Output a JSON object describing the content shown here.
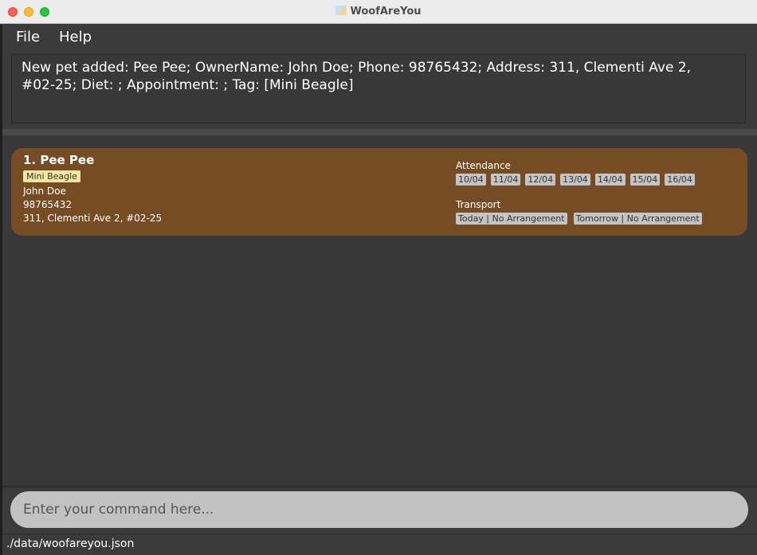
{
  "window": {
    "title": "WoofAreYou"
  },
  "menu": {
    "file": "File",
    "help": "Help"
  },
  "result": {
    "line1": "New pet added: Pee Pee; OwnerName: John Doe; Phone: 98765432; Address: 311, Clementi Ave 2,",
    "line2": "#02-25; Diet: ; Appointment: ; Tag: [Mini Beagle]"
  },
  "pets": [
    {
      "index_name": "1.  Pee Pee",
      "tag": "Mini Beagle",
      "owner": "John Doe",
      "phone": "98765432",
      "address": "311, Clementi Ave 2, #02-25",
      "attendance_label": "Attendance",
      "attendance": [
        "10/04",
        "11/04",
        "12/04",
        "13/04",
        "14/04",
        "15/04",
        "16/04"
      ],
      "transport_label": "Transport",
      "transport": [
        "Today | No Arrangement",
        "Tomorrow | No Arrangement"
      ]
    }
  ],
  "command": {
    "placeholder": "Enter your command here..."
  },
  "status": {
    "path": "./data/woofareyou.json"
  },
  "colors": {
    "card": "#754c24",
    "tag": "#f5e6a1",
    "chip": "#c4c4c4",
    "background": "#3b3b3b"
  }
}
